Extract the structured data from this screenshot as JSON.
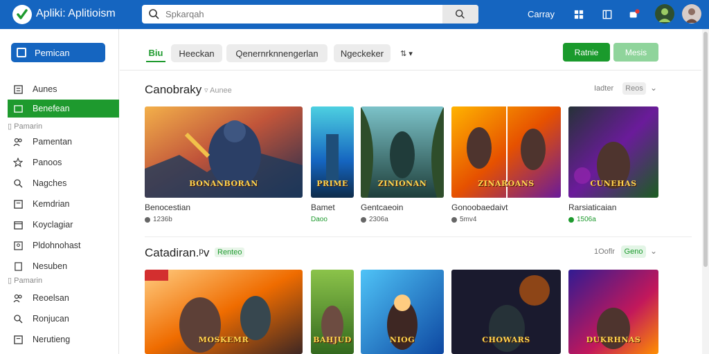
{
  "app": {
    "title": "Apliki: Aplitioism"
  },
  "search": {
    "placeholder": "Spkarqah",
    "value": ""
  },
  "topbar": {
    "label": "Carray"
  },
  "sidebar": {
    "primary_label": "Pemican",
    "items": [
      {
        "label": "Aunes"
      },
      {
        "label": "Benefean"
      },
      {
        "label": "Pamentan"
      },
      {
        "label": "Panoos"
      },
      {
        "label": "Nagches"
      },
      {
        "label": "Kemdrian"
      },
      {
        "label": "Koyclagiar"
      },
      {
        "label": "Pldohnohast"
      },
      {
        "label": "Nesuben"
      },
      {
        "label": "Reoelsan"
      },
      {
        "label": "Ronjucan"
      },
      {
        "label": "Nerutieng"
      }
    ],
    "sections": [
      {
        "label": "Pamarin"
      },
      {
        "label": "Pamarin"
      }
    ]
  },
  "filters": {
    "tabs": [
      {
        "label": "Biu"
      },
      {
        "label": "Heeckan"
      },
      {
        "label": "Qenernrknnengerlan"
      },
      {
        "label": "Ngeckeker"
      },
      {
        "label": "⇅ ▾"
      }
    ],
    "primary_button": "Ratnie",
    "secondary_button": "Mesis"
  },
  "sections": [
    {
      "title": "Canobraky",
      "subtitle": "Aunee",
      "right_label": "Iadter",
      "pill": "Reos",
      "cards": [
        {
          "name": "Benocestian",
          "meta": "1236b",
          "banner": "BONANBORAN"
        },
        {
          "name": "Bamet",
          "meta": "Daoo",
          "banner": "PRIME"
        },
        {
          "name": "Gentcaeoin",
          "meta": "2306a",
          "banner": "ZINIONAN"
        },
        {
          "name": "Gonoobaedaivt",
          "meta": "5mv4",
          "banner": "ZINAROANS"
        },
        {
          "name": "Rarsiaticaian",
          "meta": "1506a",
          "banner": "CUNEHAS"
        }
      ]
    },
    {
      "title": "Catadiran.ᵖv",
      "subtitle": "Renteo",
      "right_label": "1Ooflr",
      "pill": "Geno",
      "cards": [
        {
          "name": "",
          "meta": "",
          "banner": "MOSKEMR"
        },
        {
          "name": "",
          "meta": "",
          "banner": "BAHJUD"
        },
        {
          "name": "",
          "meta": "",
          "banner": "NIOG"
        },
        {
          "name": "",
          "meta": "",
          "banner": "CHOWARS"
        },
        {
          "name": "",
          "meta": "",
          "banner": "DUKRHNAS"
        }
      ]
    }
  ],
  "colors": {
    "brand": "#1565c0",
    "accent": "#1e9a2e"
  }
}
